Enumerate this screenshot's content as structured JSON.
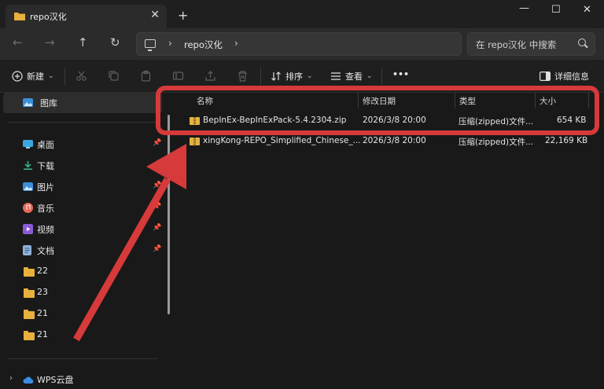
{
  "window": {
    "tab_title": "repo汉化",
    "tab_close": "✕",
    "new_tab": "+",
    "minimize": "—",
    "maximize": "☐",
    "close": "✕"
  },
  "nav": {
    "back_icon": "←",
    "forward_icon": "→",
    "up_icon": "↑",
    "refresh_icon": "↻",
    "breadcrumb_sep": "›",
    "breadcrumb": "repo汉化",
    "search_placeholder": "在 repo汉化 中搜索"
  },
  "toolbar": {
    "new_label": "新建",
    "sort_label": "排序",
    "view_label": "查看",
    "more_label": "•••",
    "details_label": "详细信息",
    "chevron": "⌄",
    "icons": [
      "cut-icon",
      "copy-icon",
      "paste-icon",
      "rename-icon",
      "share-icon",
      "delete-icon"
    ]
  },
  "sidebar": {
    "gallery": "图库",
    "items": [
      {
        "label": "桌面",
        "icon": "desktop-icon",
        "pinned": true
      },
      {
        "label": "下载",
        "icon": "download-icon",
        "pinned": true
      },
      {
        "label": "图片",
        "icon": "pictures-icon",
        "pinned": true
      },
      {
        "label": "音乐",
        "icon": "music-icon",
        "pinned": true
      },
      {
        "label": "视频",
        "icon": "video-icon",
        "pinned": true
      },
      {
        "label": "文档",
        "icon": "documents-icon",
        "pinned": true
      },
      {
        "label": "22",
        "icon": "folder-icon",
        "pinned": false
      },
      {
        "label": "23",
        "icon": "folder-icon",
        "pinned": false
      },
      {
        "label": "21",
        "icon": "folder-icon",
        "pinned": false
      },
      {
        "label": "21",
        "icon": "folder-icon",
        "pinned": false
      }
    ],
    "cloud": "WPS云盘",
    "pin_glyph": "📌",
    "expand_glyph": "›"
  },
  "list": {
    "columns": [
      "名称",
      "修改日期",
      "类型",
      "大小"
    ],
    "rows": [
      {
        "name": "BepInEx-BepInExPack-5.4.2304.zip",
        "date": "2026/3/8 20:00",
        "type": "压缩(zipped)文件...",
        "size": "654 KB"
      },
      {
        "name": "xingKong-REPO_Simplified_Chinese_...",
        "date": "2026/3/8 20:00",
        "type": "压缩(zipped)文件...",
        "size": "22,169 KB"
      }
    ]
  },
  "annotation": {
    "color": "#d63a3a"
  }
}
